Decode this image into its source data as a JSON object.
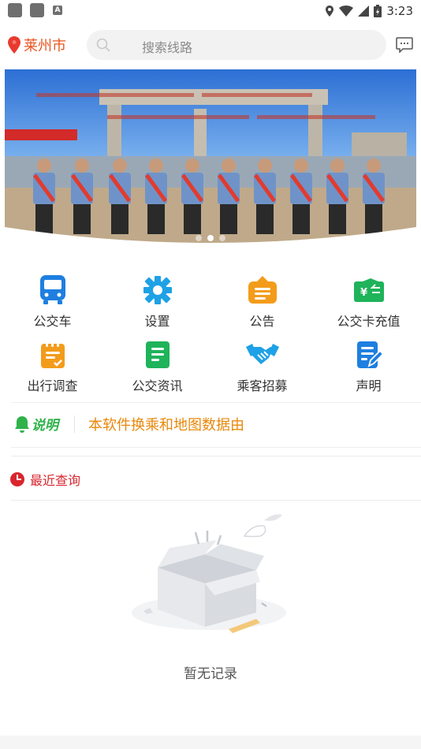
{
  "status_bar": {
    "time": "3:23",
    "notification_icon": "A"
  },
  "header": {
    "city": "莱州市",
    "search_placeholder": "搜索线路"
  },
  "banner": {
    "slides": 3,
    "active_slide": 2
  },
  "menu": [
    {
      "label": "公交车",
      "icon": "bus-icon",
      "color": "#1e7fe0"
    },
    {
      "label": "设置",
      "icon": "gear-icon",
      "color": "#1ea1e6"
    },
    {
      "label": "公告",
      "icon": "announcement-icon",
      "color": "#f39c1b"
    },
    {
      "label": "公交卡充值",
      "icon": "wallet-icon",
      "color": "#1fb35a"
    },
    {
      "label": "出行调查",
      "icon": "survey-icon",
      "color": "#f39c1b"
    },
    {
      "label": "公交资讯",
      "icon": "news-icon",
      "color": "#1fb35a"
    },
    {
      "label": "乘客招募",
      "icon": "handshake-icon",
      "color": "#1ea1e6"
    },
    {
      "label": "声明",
      "icon": "statement-icon",
      "color": "#1e7fe0"
    }
  ],
  "notice": {
    "logo_text": "说明",
    "text": "本软件换乘和地图数据由"
  },
  "recent": {
    "title": "最近查询"
  },
  "empty_state": {
    "text": "暂无记录"
  },
  "colors": {
    "accent": "#e8541e",
    "notice": "#e8880c",
    "recent": "#d8262e"
  }
}
